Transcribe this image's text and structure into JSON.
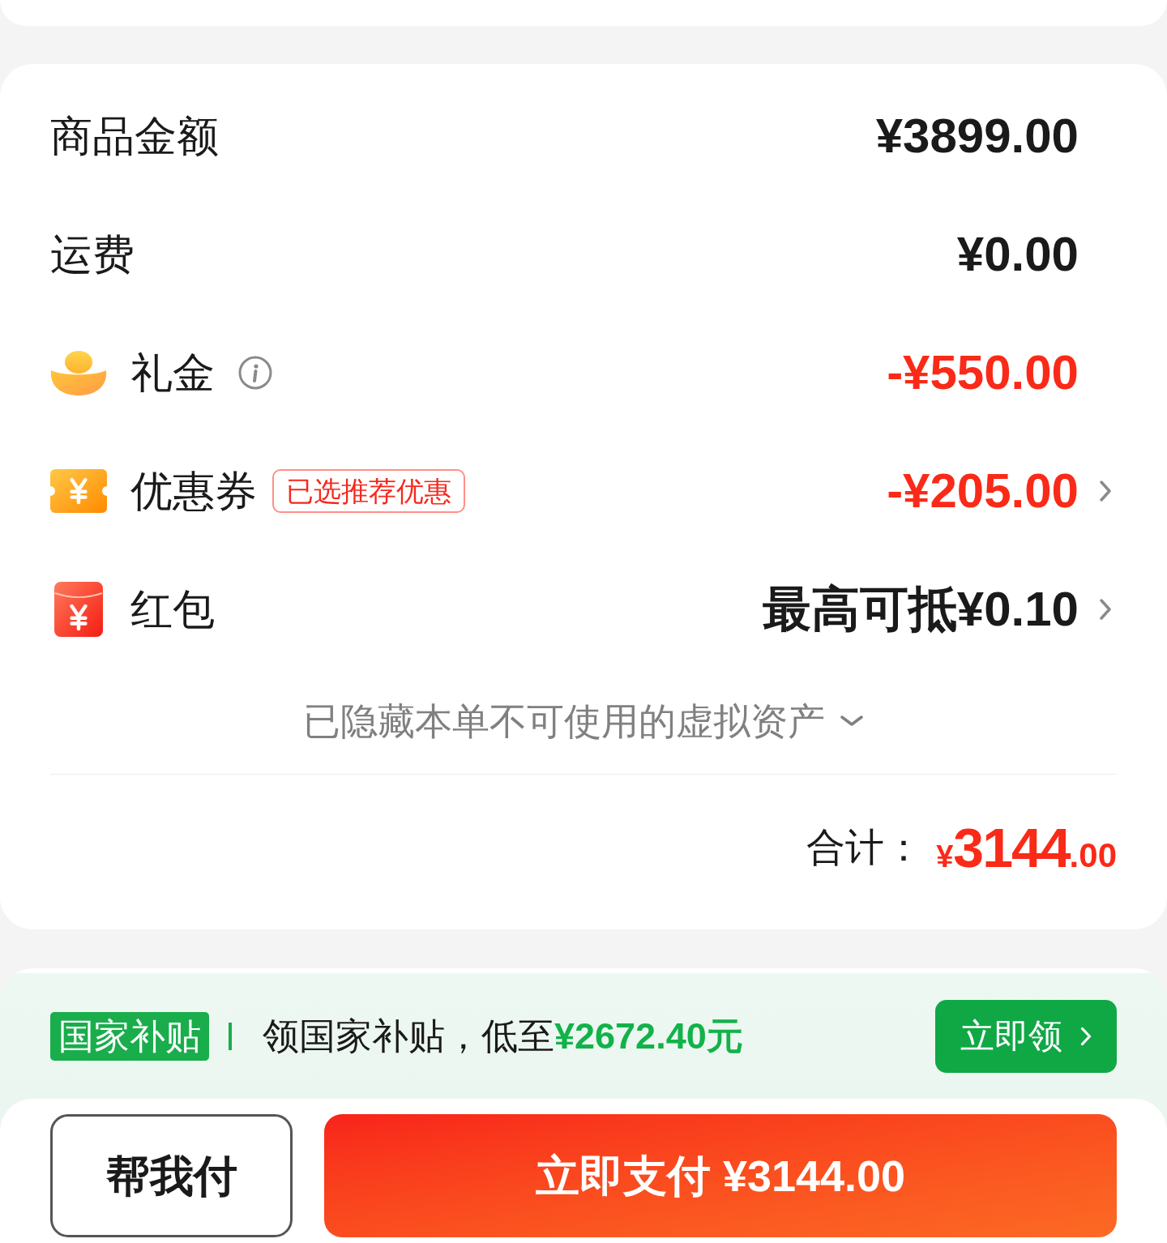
{
  "price_summary": {
    "rows": [
      {
        "kind": "plain",
        "label": "商品金额",
        "value": "¥3899.00",
        "deduction": false,
        "arrow": false
      },
      {
        "kind": "plain",
        "label": "运费",
        "value": "¥0.00",
        "deduction": false,
        "arrow": false
      },
      {
        "kind": "gift_money",
        "label": "礼金",
        "value": "-¥550.00",
        "deduction": true,
        "arrow": false
      },
      {
        "kind": "coupon",
        "label": "优惠券",
        "tag": "已选推荐优惠",
        "value": "-¥205.00",
        "deduction": true,
        "arrow": true
      },
      {
        "kind": "red_packet",
        "label": "红包",
        "value": "最高可抵¥0.10",
        "deduction": false,
        "arrow": true
      }
    ],
    "hidden_assets": {
      "text": "已隐藏本单不可使用的虚拟资产",
      "expanded": false
    },
    "total": {
      "label": "合计：",
      "currency": "¥",
      "integer": "3144",
      "decimal": ".00"
    }
  },
  "subsidy_banner": {
    "badge": "国家补贴",
    "text": "领国家补贴，低至",
    "amount": "¥2672.40元",
    "button": "立即领"
  },
  "bottom_bar": {
    "secondary_button": "帮我付",
    "pay_button": "立即支付 ¥3144.00"
  }
}
